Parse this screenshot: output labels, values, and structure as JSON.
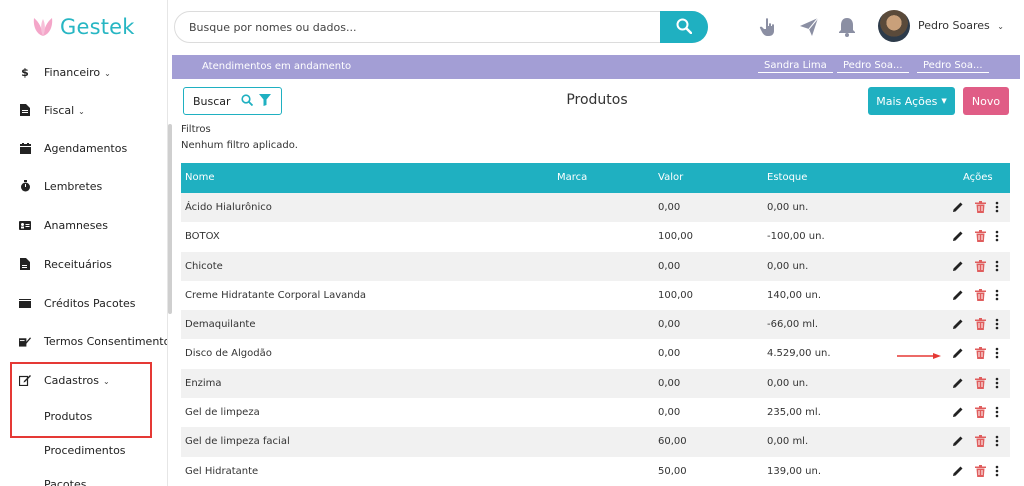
{
  "app": {
    "brand": "Gestek",
    "brand_color": "#27b6c3",
    "accent_color": "#1fb0c1",
    "danger_color": "#e05d86"
  },
  "sidebar": {
    "items": [
      {
        "label": "Financeiro",
        "icon": "dollar-icon",
        "has_dropdown": true
      },
      {
        "label": "Fiscal",
        "icon": "document-icon",
        "has_dropdown": true
      },
      {
        "label": "Agendamentos",
        "icon": "calendar-icon",
        "has_dropdown": false
      },
      {
        "label": "Lembretes",
        "icon": "stopwatch-icon",
        "has_dropdown": false
      },
      {
        "label": "Anamneses",
        "icon": "id-card-icon",
        "has_dropdown": false
      },
      {
        "label": "Receituários",
        "icon": "prescription-icon",
        "has_dropdown": false
      },
      {
        "label": "Créditos Pacotes",
        "icon": "ticket-icon",
        "has_dropdown": false
      },
      {
        "label": "Termos Consentimento",
        "icon": "signature-icon",
        "has_dropdown": false
      },
      {
        "label": "Cadastros",
        "icon": "edit-icon",
        "has_dropdown": true
      }
    ],
    "subitems": [
      "Produtos",
      "Procedimentos",
      "Pacotes"
    ]
  },
  "header": {
    "search_placeholder": "Busque por nomes ou dados...",
    "user_name": "Pedro Soares"
  },
  "attendance": {
    "title": "Atendimentos em andamento",
    "chips": [
      "Sandra Lima",
      "Pedro Soa...",
      "Pedro Soa..."
    ]
  },
  "page": {
    "title": "Produtos",
    "search_button": "Buscar",
    "more_actions": "Mais Ações",
    "new_button": "Novo",
    "filters_label": "Filtros",
    "filters_value": "Nenhum filtro aplicado."
  },
  "table": {
    "columns": [
      "Nome",
      "Marca",
      "Valor",
      "Estoque",
      "Ações"
    ],
    "rows": [
      {
        "nome": "Ácido Hialurônico",
        "marca": "",
        "valor": "0,00",
        "estoque": "0,00 un."
      },
      {
        "nome": "BOTOX",
        "marca": "",
        "valor": "100,00",
        "estoque": "-100,00 un."
      },
      {
        "nome": "Chicote",
        "marca": "",
        "valor": "0,00",
        "estoque": "0,00 un."
      },
      {
        "nome": "Creme Hidratante Corporal Lavanda",
        "marca": "",
        "valor": "100,00",
        "estoque": "140,00 un."
      },
      {
        "nome": "Demaquilante",
        "marca": "",
        "valor": "0,00",
        "estoque": "-66,00 ml."
      },
      {
        "nome": "Disco de Algodão",
        "marca": "",
        "valor": "0,00",
        "estoque": "4.529,00 un."
      },
      {
        "nome": "Enzima",
        "marca": "",
        "valor": "0,00",
        "estoque": "0,00 un."
      },
      {
        "nome": "Gel de limpeza",
        "marca": "",
        "valor": "0,00",
        "estoque": "235,00 ml."
      },
      {
        "nome": "Gel de limpeza facial",
        "marca": "",
        "valor": "60,00",
        "estoque": "0,00 ml."
      },
      {
        "nome": "Gel Hidratante",
        "marca": "",
        "valor": "50,00",
        "estoque": "139,00 un."
      }
    ]
  }
}
